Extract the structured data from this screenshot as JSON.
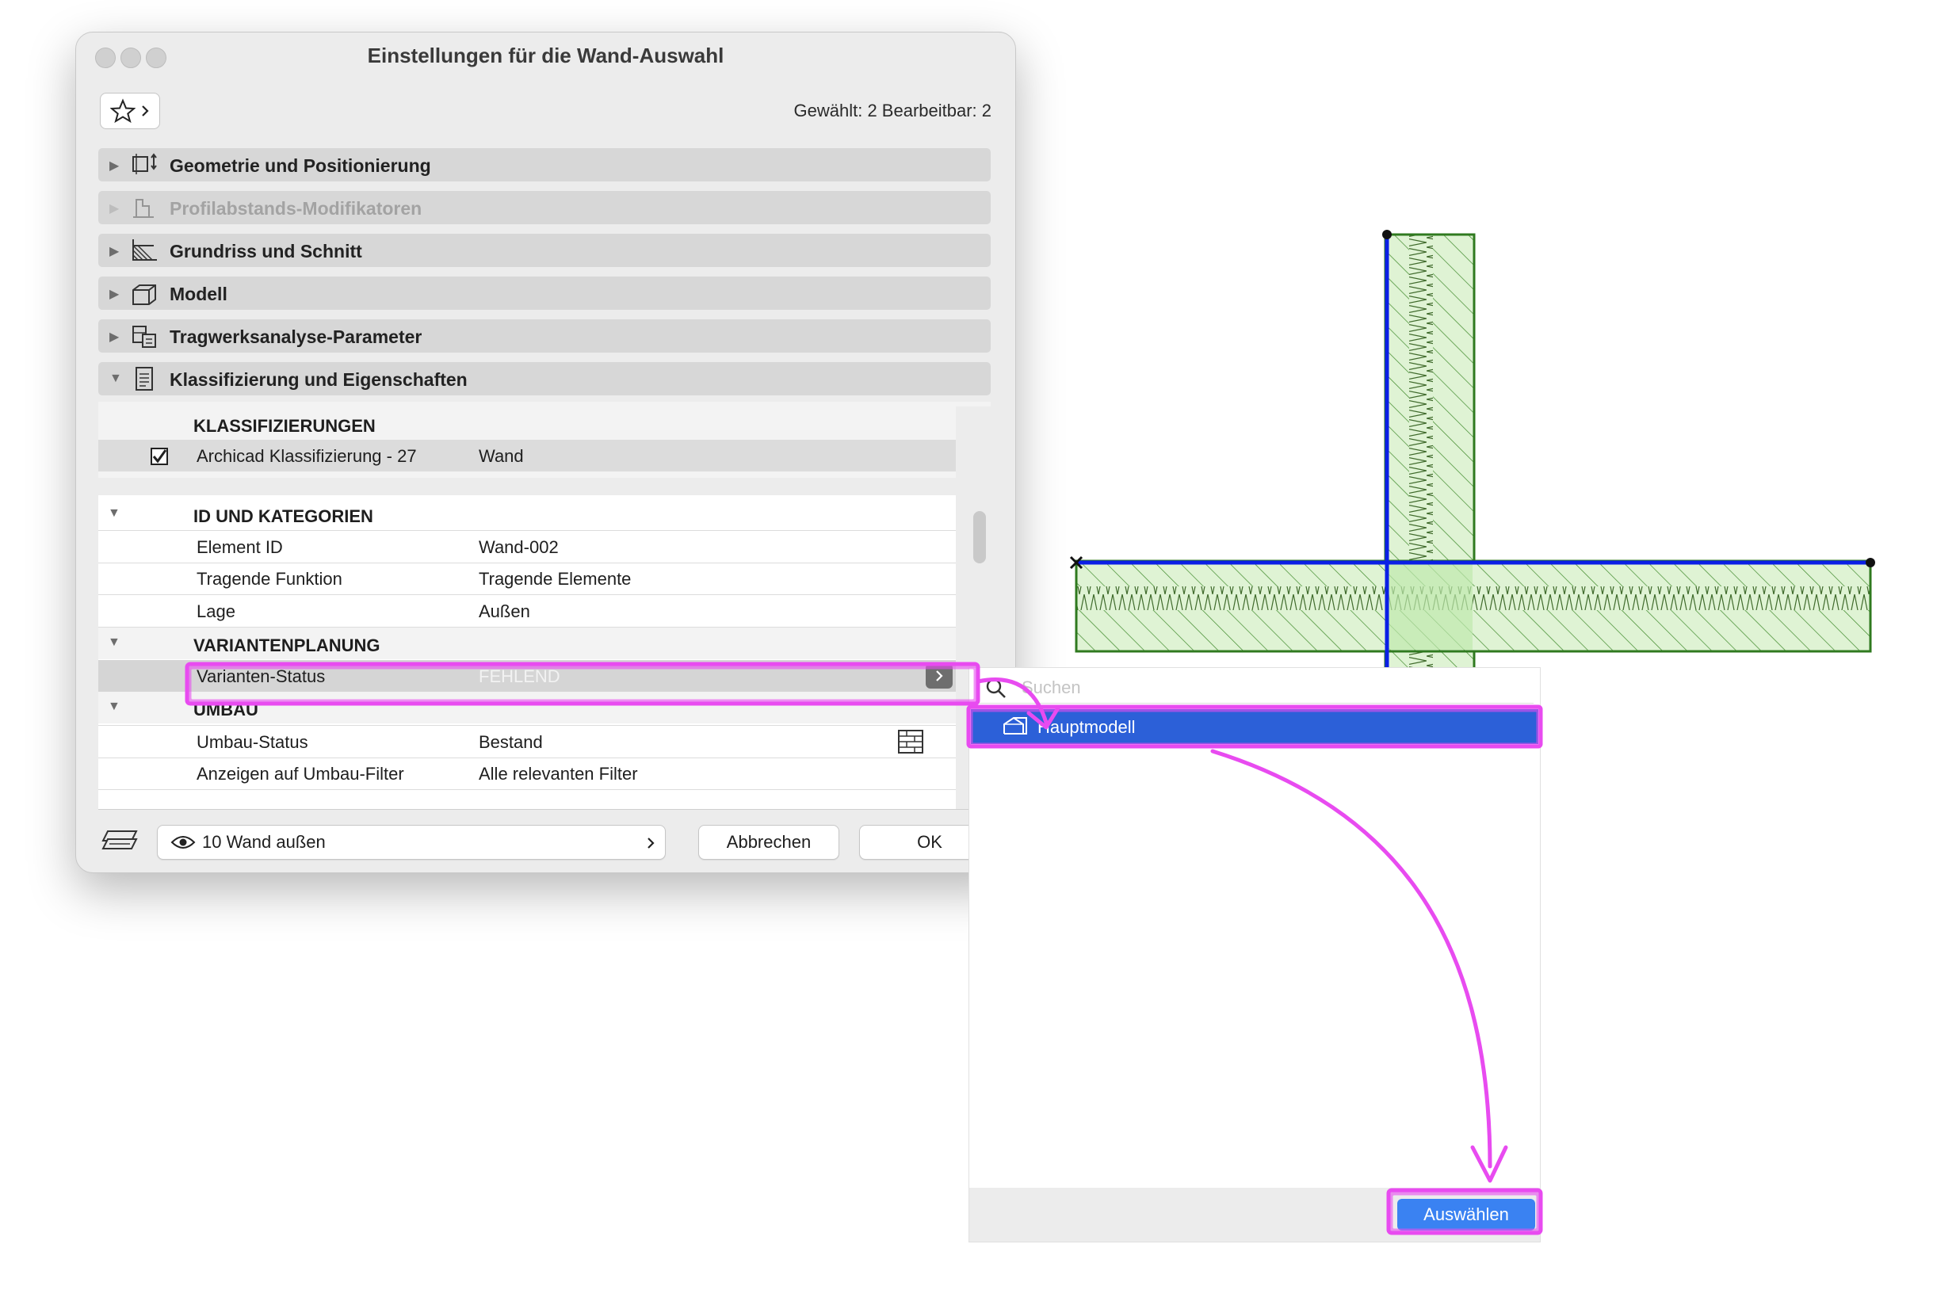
{
  "dialog": {
    "title": "Einstellungen für die Wand-Auswahl",
    "selection_info": "Gewählt: 2 Bearbeitbar: 2",
    "panels": [
      {
        "label": "Geometrie und Positionierung",
        "icon": "geometry-icon",
        "enabled": true
      },
      {
        "label": "Profilabstands-Modifikatoren",
        "icon": "profile-icon",
        "enabled": false
      },
      {
        "label": "Grundriss und Schnitt",
        "icon": "floorplan-icon",
        "enabled": true
      },
      {
        "label": "Modell",
        "icon": "model-icon",
        "enabled": true
      },
      {
        "label": "Tragwerksanalyse-Parameter",
        "icon": "structural-icon",
        "enabled": true
      },
      {
        "label": "Klassifizierung und Eigenschaften",
        "icon": "document-icon",
        "enabled": true,
        "expanded": true
      }
    ],
    "classifications": {
      "header": "KLASSIFIZIERUNGEN",
      "row": {
        "checked": true,
        "name": "Archicad Klassifizierung - 27",
        "value": "Wand"
      }
    },
    "properties": {
      "id_group": "ID UND KATEGORIEN",
      "element_id_label": "Element ID",
      "element_id_value": "Wand-002",
      "structural_label": "Tragende Funktion",
      "structural_value": "Tragende Elemente",
      "position_label": "Lage",
      "position_value": "Außen",
      "variant_group": "VARIANTENPLANUNG",
      "variant_label": "Varianten-Status",
      "variant_value": "FEHLEND",
      "renovation_group": "UMBAU",
      "renovation_label": "Umbau-Status",
      "renovation_value": "Bestand",
      "filter_label": "Anzeigen auf Umbau-Filter",
      "filter_value": "Alle relevanten Filter"
    },
    "footer": {
      "layer": "10 Wand außen",
      "cancel": "Abbrechen",
      "ok": "OK"
    }
  },
  "popup": {
    "search_placeholder": "Suchen",
    "item": "Hauptmodell",
    "select_button": "Auswählen"
  },
  "colors": {
    "highlight": "#2c60d8",
    "annotation": "#e84bf0",
    "wall_fill": "#dff3d4",
    "wall_outline": "#2f7a1f",
    "reference_line": "#0b1fe6"
  }
}
